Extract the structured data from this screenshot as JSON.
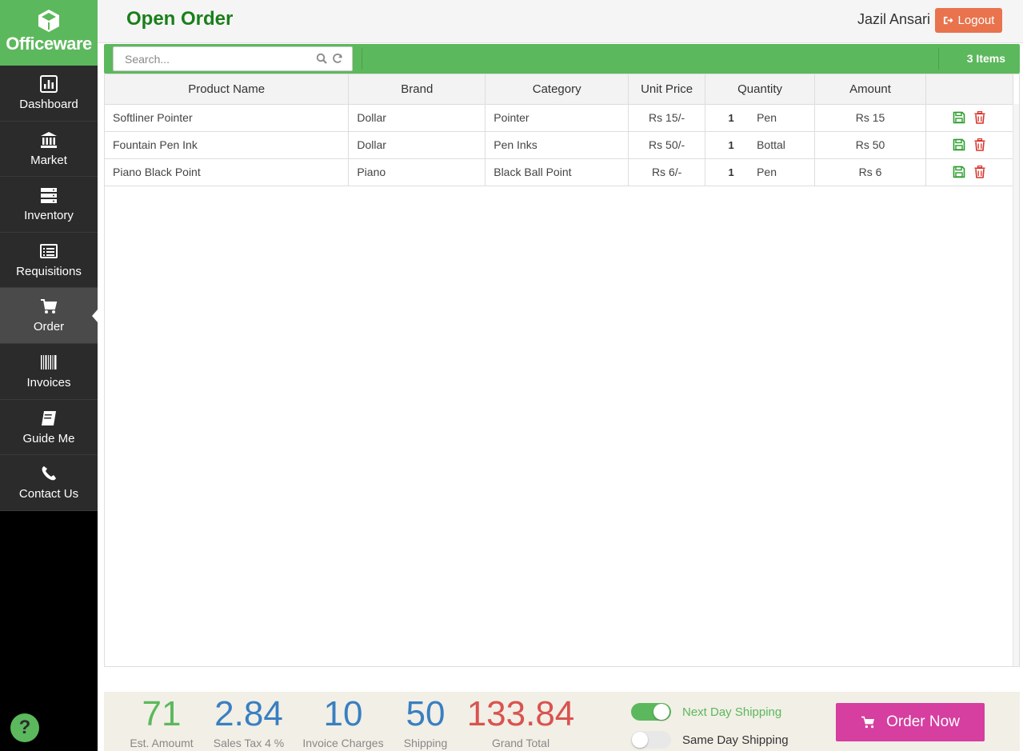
{
  "brand": {
    "name": "Officeware"
  },
  "sidebar": {
    "items": [
      {
        "label": "Dashboard",
        "icon": "bar-chart-icon"
      },
      {
        "label": "Market",
        "icon": "bank-icon"
      },
      {
        "label": "Inventory",
        "icon": "server-stack-icon"
      },
      {
        "label": "Requisitions",
        "icon": "list-alt-icon"
      },
      {
        "label": "Order",
        "icon": "shopping-cart-icon",
        "active": true
      },
      {
        "label": "Invoices",
        "icon": "barcode-icon"
      },
      {
        "label": "Guide Me",
        "icon": "book-icon"
      },
      {
        "label": "Contact Us",
        "icon": "phone-icon"
      }
    ]
  },
  "header": {
    "title": "Open Order",
    "user": "Jazil Ansari",
    "logout_label": "Logout"
  },
  "toolbar": {
    "search_placeholder": "Search...",
    "search_value": "",
    "item_count": "3 Items"
  },
  "table": {
    "columns": [
      "Product Name",
      "Brand",
      "Category",
      "Unit Price",
      "Quantity",
      "Amount"
    ],
    "rows": [
      {
        "product": "Softliner Pointer",
        "brand": "Dollar",
        "category": "Pointer",
        "unit_price": "Rs 15/-",
        "qty": "1",
        "unit": "Pen",
        "amount": "Rs 15"
      },
      {
        "product": "Fountain Pen Ink",
        "brand": "Dollar",
        "category": "Pen Inks",
        "unit_price": "Rs 50/-",
        "qty": "1",
        "unit": "Bottal",
        "amount": "Rs 50"
      },
      {
        "product": "Piano Black Point",
        "brand": "Piano",
        "category": "Black Ball Point",
        "unit_price": "Rs 6/-",
        "qty": "1",
        "unit": "Pen",
        "amount": "Rs 6"
      }
    ]
  },
  "summary": {
    "est_amount": {
      "value": "71",
      "label": "Est. Amoumt",
      "color": "#5cb85c"
    },
    "sales_tax": {
      "value": "2.84",
      "label": "Sales Tax 4 %",
      "color": "#3a7fc1"
    },
    "invoice_charges": {
      "value": "10",
      "label": "Invoice Charges",
      "color": "#3a7fc1"
    },
    "shipping": {
      "value": "50",
      "label": "Shipping",
      "color": "#3a7fc1"
    },
    "grand_total": {
      "value": "133.84",
      "label": "Grand Total",
      "color": "#d9534f"
    }
  },
  "shipping_options": {
    "next_day": {
      "label": "Next Day Shipping",
      "on": true
    },
    "same_day": {
      "label": "Same Day Shipping",
      "on": false
    }
  },
  "order_button": {
    "label": "Order Now"
  },
  "help": {
    "label": "?"
  },
  "colors": {
    "green": "#5cb85c",
    "title_green": "#1a7f1a",
    "logout": "#e8734d",
    "order": "#d63ea0",
    "sidebar": "#2b2b2b"
  }
}
